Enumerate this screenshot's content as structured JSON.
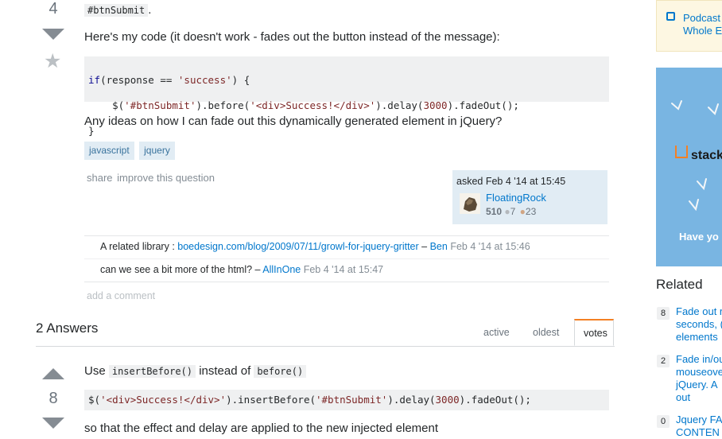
{
  "question": {
    "vote_count": "4",
    "intro_code": "#btnSubmit",
    "intro_tail": ".",
    "here_text": "Here's my code (it doesn't work - fades out the button instead of the message):",
    "code_lines": [
      "if(response == 'success') {",
      "    $('#btnSubmit').before('<div>Success!</div>').delay(3000).fadeOut();",
      "}"
    ],
    "ideas_text": "Any ideas on how I can fade out this dynamically generated element in jQuery?",
    "tags": [
      "javascript",
      "jquery"
    ],
    "share_label": "share",
    "improve_label": "improve this question",
    "asked_label": "asked Feb 4 '14 at 15:45",
    "user_name": "FloatingRock",
    "user_rep": "510",
    "silver_badges": "7",
    "bronze_badges": "23"
  },
  "comments": [
    {
      "text": "A related library : ",
      "link": "boedesign.com/blog/2009/07/11/growl-for-jquery-gritter",
      "sep": " – ",
      "user": "Ben",
      "time": "Feb 4 '14 at 15:46"
    },
    {
      "text": "can we see a bit more of the html? – ",
      "user": "AllInOne",
      "time": "Feb 4 '14 at 15:47"
    }
  ],
  "add_comment_label": "add a comment",
  "answers_header": {
    "title": "2 Answers",
    "tabs": [
      "active",
      "oldest",
      "votes"
    ],
    "active_tab": "votes"
  },
  "answer": {
    "vote_count": "8",
    "use_text": "Use",
    "insert_before": "insertBefore()",
    "instead_of": "instead of",
    "before": "before()",
    "code": "$('<div>Success!</div>').insertBefore('#btnSubmit').delay(3000).fadeOut();",
    "trailing": "so that the effect and delay are applied to the new injected element"
  },
  "sidebar": {
    "podcast_lines": [
      "Podcast",
      "Whole E"
    ],
    "ad_text": "stack",
    "ad_cta": "Have yo",
    "related_title": "Related",
    "related": [
      {
        "count": "8",
        "lines": [
          "Fade out r",
          "seconds, (",
          "elements"
        ]
      },
      {
        "count": "2",
        "lines": [
          "Fade in/ou",
          "mouseove",
          "jQuery. A",
          "out"
        ]
      },
      {
        "count": "0",
        "lines": [
          "Jquery FA",
          "CONTEN"
        ]
      }
    ]
  },
  "colors": {
    "link": "#0077cc",
    "tag_bg": "#e1ecf4",
    "tag_text": "#39739d",
    "ad_bg": "#79b5e2",
    "owner_bg": "#e1ecf4",
    "tab_active": "#f48024",
    "code_bg": "#eff0f1"
  }
}
